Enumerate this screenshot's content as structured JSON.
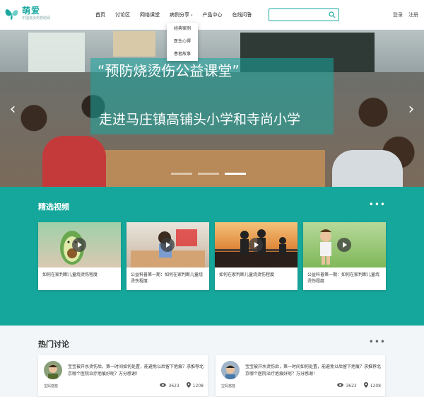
{
  "logo": {
    "title": "萌爱",
    "subtitle": "中国烧烫伤救助网"
  },
  "nav": {
    "items": [
      {
        "label": "首页"
      },
      {
        "label": "讨论区"
      },
      {
        "label": "网络课堂"
      },
      {
        "label": "病例分享"
      },
      {
        "label": "产品中心"
      },
      {
        "label": "在线问答"
      }
    ],
    "dropdown": [
      "经典案例",
      "医生心得",
      "患者故事"
    ]
  },
  "search": {
    "placeholder": ""
  },
  "auth": {
    "login": "登录",
    "register": "注册"
  },
  "hero": {
    "line1": "“预防烧烫伤公益课堂”",
    "line2": "走进马庄镇高铺头小学和寺尚小学"
  },
  "videos": {
    "title": "精选视频",
    "more": "•••",
    "items": [
      {
        "caption": "如何在家判断儿童烧烫伤程度"
      },
      {
        "caption": "公益科普第一期：如何在家判断儿童烧烫伤程度"
      },
      {
        "caption": "如何在家判断儿童烧烫伤程度"
      },
      {
        "caption": "公益科普第一期：如何在家判断儿童烧烫伤程度"
      }
    ]
  },
  "hot": {
    "title": "热门讨论",
    "more": "•••",
    "items": [
      {
        "user": "宝妈悠悠",
        "text": "宝宝被开水烫伤后，第一时间如何处置，能避免以后留下疤痕？求推荐北京哪个医院治疗疤痕好呢？万分感谢！",
        "views": "3623",
        "comments": "1208"
      },
      {
        "user": "宝妈悠悠",
        "text": "宝宝被开水烫伤后，第一时间如何处置，能避免以后留下疤痕？求推荐北京哪个医院治疗疤痕好呢？万分感谢！",
        "views": "3623",
        "comments": "1208"
      }
    ]
  },
  "colors": {
    "brand": "#16a79c",
    "text": "#333333"
  }
}
